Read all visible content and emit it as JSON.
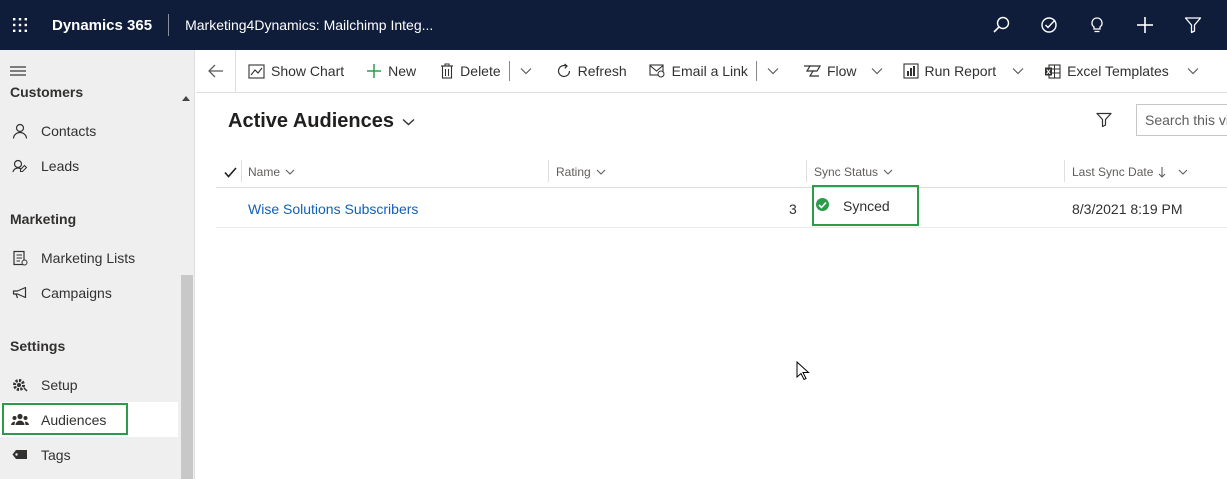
{
  "topbar": {
    "app_name": "Dynamics 365",
    "app_title": "Marketing4Dynamics: Mailchimp Integ..."
  },
  "sidebar": {
    "group_customers": "Customers",
    "contacts": "Contacts",
    "leads": "Leads",
    "group_marketing": "Marketing",
    "marketing_lists": "Marketing Lists",
    "campaigns": "Campaigns",
    "group_settings": "Settings",
    "setup": "Setup",
    "audiences": "Audiences",
    "tags": "Tags"
  },
  "cmdbar": {
    "show_chart": "Show Chart",
    "new": "New",
    "delete": "Delete",
    "refresh": "Refresh",
    "email_link": "Email a Link",
    "flow": "Flow",
    "run_report": "Run Report",
    "excel_templates": "Excel Templates"
  },
  "view": {
    "title": "Active Audiences",
    "search_placeholder": "Search this view"
  },
  "grid": {
    "columns": {
      "name": "Name",
      "rating": "Rating",
      "sync_status": "Sync Status",
      "last_sync_date": "Last Sync Date"
    },
    "rows": [
      {
        "name": "Wise Solutions Subscribers",
        "rating": "3",
        "sync_status": "Synced",
        "last_sync_date": "8/3/2021 8:19 PM"
      }
    ]
  },
  "colors": {
    "nav_bg": "#0f1c3a",
    "highlight_green": "#2e9b4b",
    "link_blue": "#1160b7"
  }
}
